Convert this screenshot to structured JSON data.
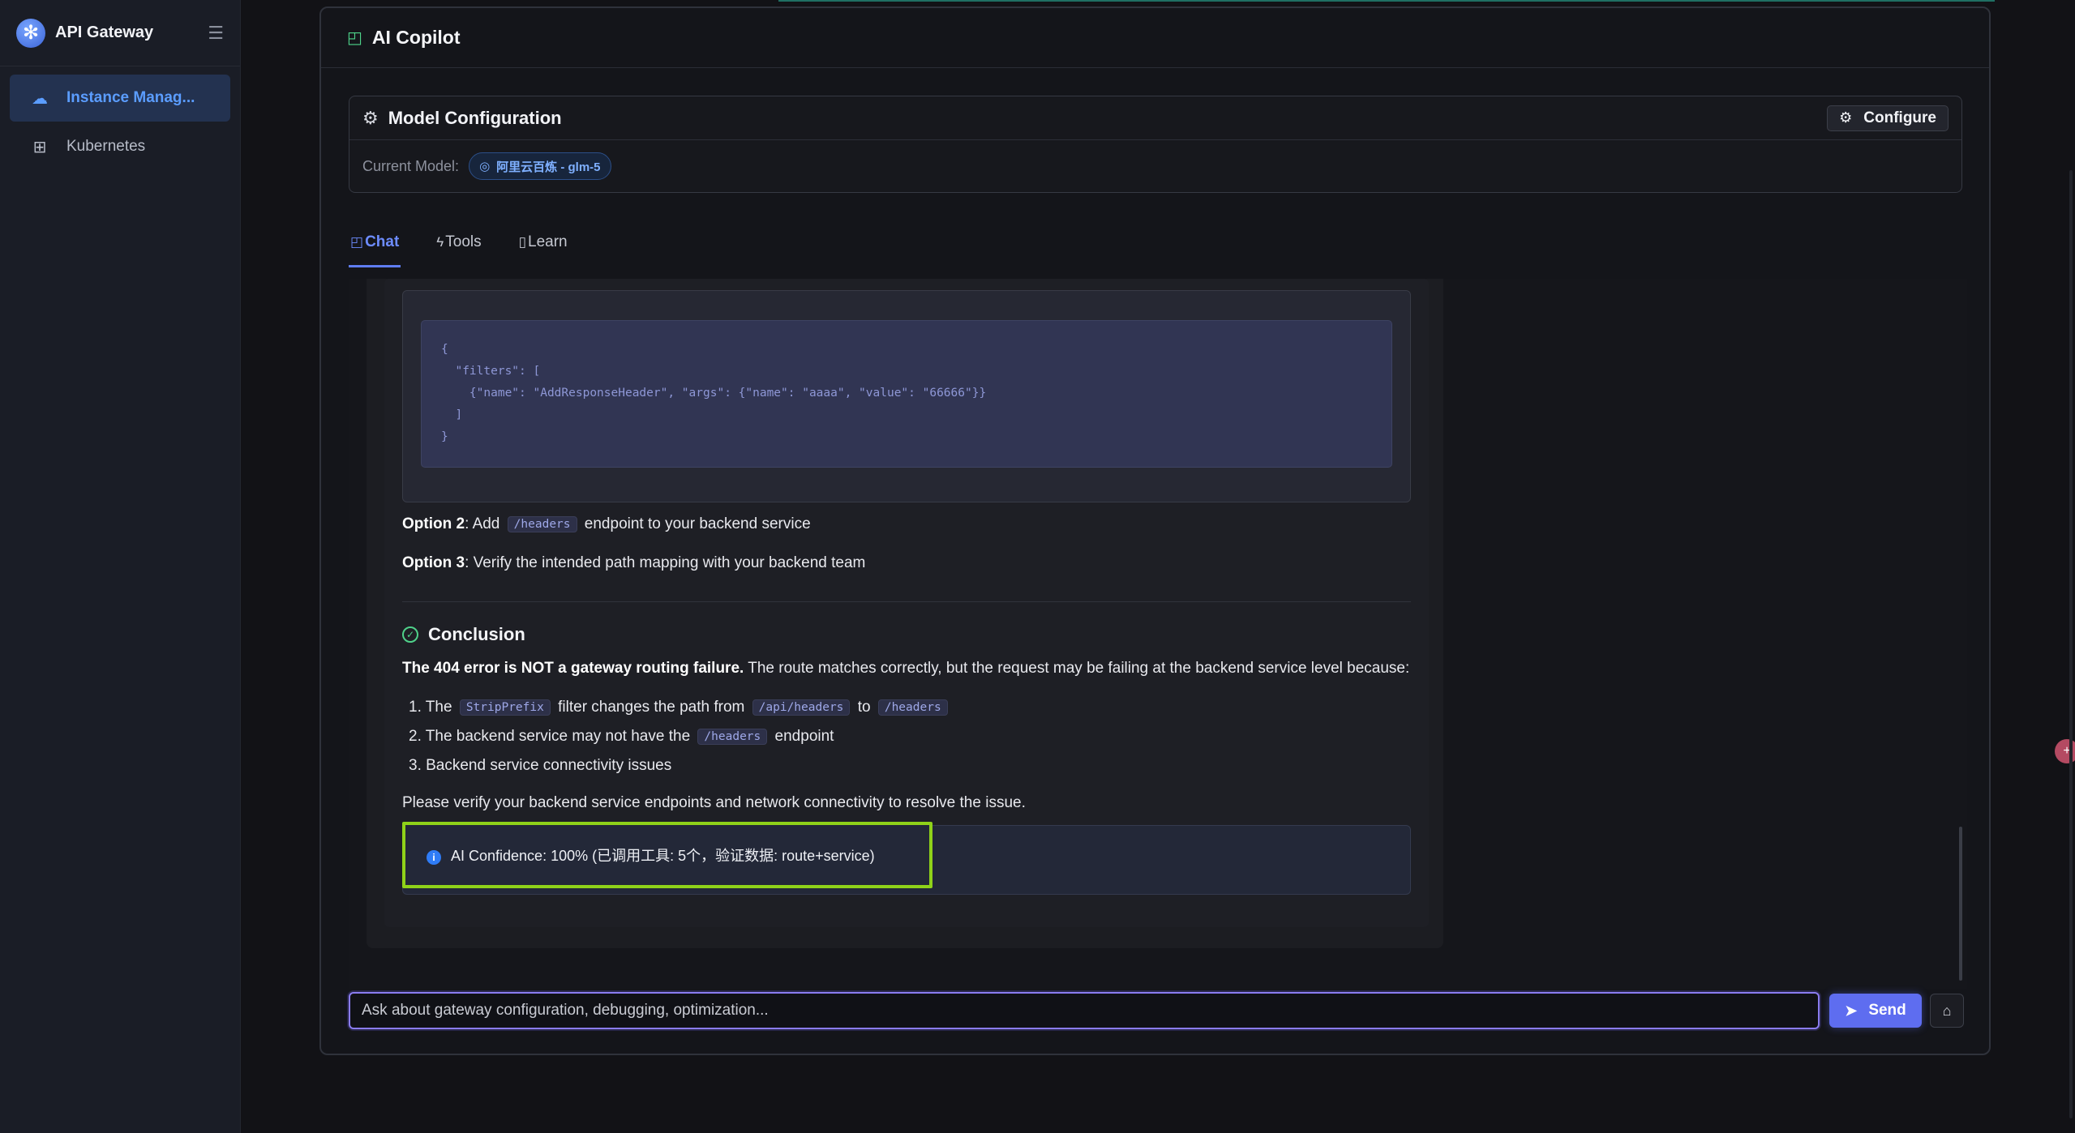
{
  "sidebar": {
    "brand": "API Gateway",
    "items": [
      {
        "label": "Instance Manag...",
        "icon": "cloud-icon",
        "active": true
      },
      {
        "label": "Kubernetes",
        "icon": "cluster-icon",
        "active": false
      }
    ]
  },
  "panel": {
    "title": "AI Copilot",
    "model_config": {
      "title": "Model Configuration",
      "configure_label": "Configure",
      "current_model_label": "Current Model:",
      "current_model_value": "阿里云百炼 - glm-5"
    },
    "tabs": [
      {
        "label": "Chat",
        "active": true
      },
      {
        "label": "Tools",
        "active": false
      },
      {
        "label": "Learn",
        "active": false
      }
    ]
  },
  "message": {
    "code": "{\n  \"filters\": [\n    {\"name\": \"AddResponseHeader\", \"args\": {\"name\": \"aaaa\", \"value\": \"66666\"}}\n  ]\n}",
    "option2_label": "Option 2",
    "option2_pre": ": Add",
    "option2_code": "/headers",
    "option2_post": "endpoint to your backend service",
    "option3_label": "Option 3",
    "option3_text": ": Verify the intended path mapping with your backend team",
    "conclusion_title": "Conclusion",
    "conclusion_bold": "The 404 error is NOT a gateway routing failure.",
    "conclusion_text": "The route matches correctly, but the request may be failing at the backend service level because:",
    "list": {
      "item1_pre": "1. The",
      "item1_code1": "StripPrefix",
      "item1_mid": "filter changes the path from",
      "item1_code2": "/api/headers",
      "item1_to": "to",
      "item1_code3": "/headers",
      "item2_pre": "2. The backend service may not have the",
      "item2_code": "/headers",
      "item2_post": "endpoint",
      "item3": "3. Backend service connectivity issues"
    },
    "closing": "Please verify your backend service endpoints and network connectivity to resolve the issue.",
    "confidence": "AI Confidence: 100% (已调用工具: 5个，验证数据: route+service)"
  },
  "input": {
    "placeholder": "Ask about gateway configuration, debugging, optimization...",
    "send_label": "Send"
  },
  "colors": {
    "accent": "#5e6df0",
    "highlight_border": "#8fd219",
    "success": "#4fd18a",
    "info": "#2f7cf6"
  }
}
